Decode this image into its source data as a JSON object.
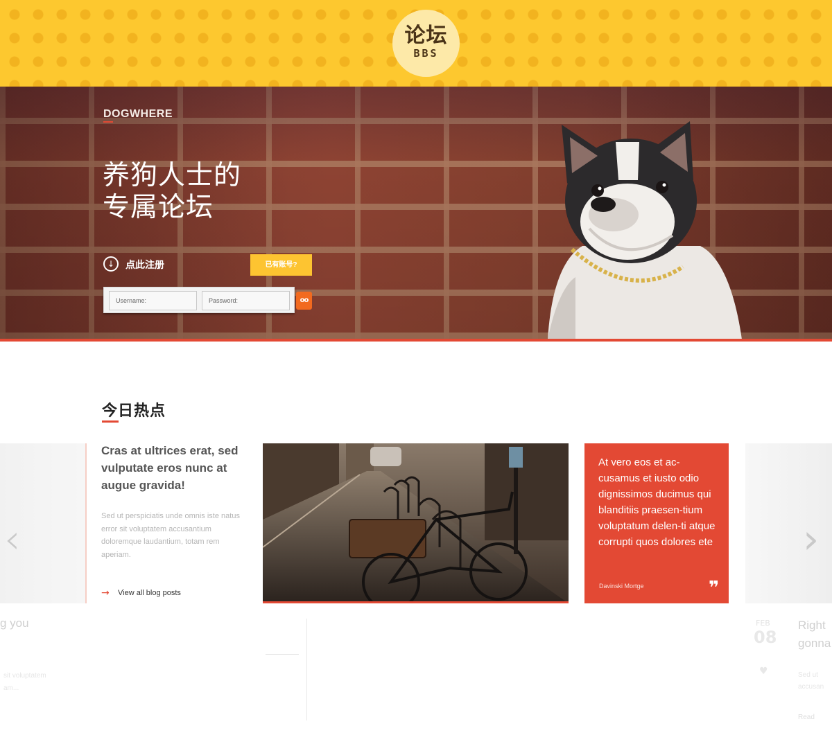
{
  "header": {
    "logo_cn": "论坛",
    "logo_en": "BBS"
  },
  "hero": {
    "brand": "DOGWHERE",
    "title_line1": "养狗人士的",
    "title_line2": "专属论坛",
    "register_label": "点此注册",
    "have_account_label": "已有账号?",
    "username_placeholder": "Username:",
    "password_placeholder": "Password:",
    "login_button_icon": "goggles-icon"
  },
  "hot": {
    "section_title": "今日热点",
    "post_title": "Cras at ultrices erat, sed vulputate eros nunc at augue gravida!",
    "post_excerpt": "Sed ut perspiciatis unde omnis iste natus error sit voluptatem accusantium doloremque laudantium, totam rem aperiam.",
    "view_all": "View all blog posts",
    "quote_text": "At vero eos et ac-cusamus et iusto odio dignissimos ducimus qui blanditiis praesen-tium voluptatum delen-ti atque corrupti quos dolores ete",
    "quote_author": "Davinski Mortge",
    "quote_mark": "❞"
  },
  "faded": {
    "left_title_fragment": "g you",
    "left_excerpt_fragment_1": "sit voluptatem",
    "left_excerpt_fragment_2": "am...",
    "date_month": "FEB",
    "date_day": "08",
    "right_title_fragment_1": "Right",
    "right_title_fragment_2": "gonna",
    "right_excerpt_fragment_1": "Sed ut",
    "right_excerpt_fragment_2": "accusan",
    "right_read_fragment": "Read"
  },
  "colors": {
    "yellow": "#fdc82f",
    "accent_red": "#e34934",
    "button_yellow": "#fdc431",
    "login_orange": "#f26a1f"
  }
}
